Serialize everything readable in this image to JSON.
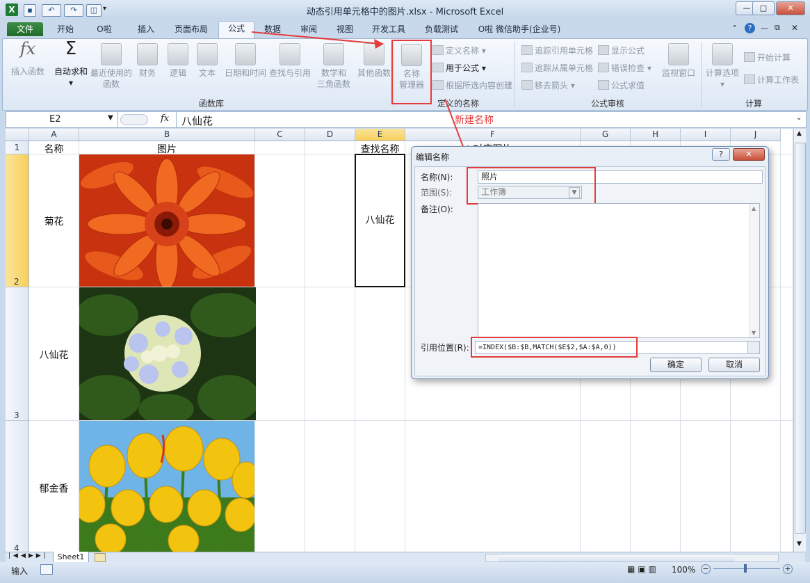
{
  "window": {
    "title": "动态引用单元格中的图片.xlsx - Microsoft Excel",
    "minimize": "—",
    "restore": "□",
    "close": "✕"
  },
  "tabs": [
    "文件",
    "开始",
    "O啦",
    "插入",
    "页面布局",
    "公式",
    "数据",
    "审阅",
    "视图",
    "开发工具",
    "负载测试",
    "O啦 微信助手(企业号)"
  ],
  "active_tab": "公式",
  "ribbon": {
    "insert_function": "插入函数",
    "autosum": "自动求和",
    "recent_line1": "最近使用的",
    "recent_line2": "函数",
    "financial": "财务",
    "logical": "逻辑",
    "text": "文本",
    "datetime": "日期和时间",
    "lookup": "查找与引用",
    "math_line1": "数学和",
    "math_line2": "三角函数",
    "more": "其他函数",
    "group_library": "函数库",
    "name_manager_line1": "名称",
    "name_manager_line2": "管理器",
    "define_name": "定义名称",
    "use_in_formula": "用于公式",
    "create_from_selection": "根据所选内容创建",
    "group_defined_names": "定义的名称",
    "trace_precedents": "追踪引用单元格",
    "trace_dependents": "追踪从属单元格",
    "remove_arrows": "移去箭头",
    "show_formulas": "显示公式",
    "error_checking": "错误检查",
    "evaluate_formula": "公式求值",
    "watch_window": "监视窗口",
    "group_auditing": "公式审核",
    "calc_options": "计算选项",
    "calc_now": "开始计算",
    "calc_sheet": "计算工作表",
    "group_calculation": "计算"
  },
  "formula_bar": {
    "name_box": "E2",
    "fx": "fx",
    "content": "八仙花"
  },
  "annotation": "新建名称",
  "columns": [
    "A",
    "B",
    "C",
    "D",
    "E",
    "F",
    "G",
    "H",
    "I",
    "J"
  ],
  "rows": [
    "1",
    "2",
    "3",
    "4"
  ],
  "cells": {
    "A1": "名称",
    "B1": "图片",
    "E1": "查找名称",
    "F1": "对应图片",
    "A2": "菊花",
    "E2": "八仙花",
    "A3": "八仙花",
    "A4": "郁金香"
  },
  "dialog": {
    "title": "编辑名称",
    "help": "?",
    "close": "✕",
    "name_label": "名称(N):",
    "name_value": "照片",
    "scope_label": "范围(S):",
    "scope_value": "工作簿",
    "comment_label": "备注(O):",
    "refers_label": "引用位置(R):",
    "refers_value": "=INDEX($B:$B,MATCH($E$2,$A:$A,0))",
    "ok": "确定",
    "cancel": "取消"
  },
  "sheet_tab": "Sheet1",
  "status": {
    "mode": "输入",
    "zoom": "100%"
  },
  "colors": {
    "accent_red": "#e53b3b",
    "file_tab": "#2a7a35",
    "selection": "#f7cf5a"
  }
}
